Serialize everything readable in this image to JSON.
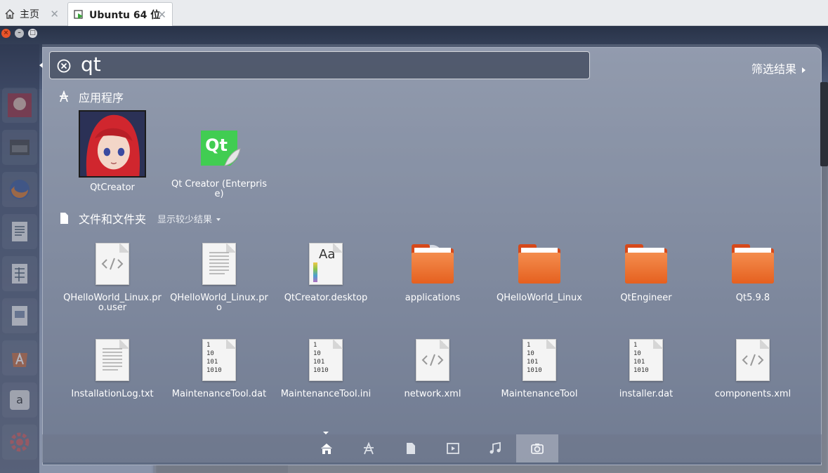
{
  "tabs": [
    {
      "label": "主页",
      "icon": "home-icon"
    },
    {
      "label": "Ubuntu 64 位",
      "icon": "vm-icon",
      "active": true
    }
  ],
  "search": {
    "query": "qt"
  },
  "filter_label": "筛选结果",
  "categories": {
    "apps": {
      "title": "应用程序",
      "icon": "apps-icon"
    },
    "files": {
      "title": "文件和文件夹",
      "icon": "file-icon",
      "show_less": "显示较少结果"
    }
  },
  "apps": [
    {
      "label": "QtCreator",
      "icon": "anime-avatar-icon"
    },
    {
      "label": "Qt Creator (Enterprise)",
      "icon": "qt-logo-icon"
    }
  ],
  "files": [
    {
      "label": "QHelloWorld_Linux.pro.user",
      "kind": "code"
    },
    {
      "label": "QHelloWorld_Linux.pro",
      "kind": "text"
    },
    {
      "label": "QtCreator.desktop",
      "kind": "font"
    },
    {
      "label": "applications",
      "kind": "folder"
    },
    {
      "label": "QHelloWorld_Linux",
      "kind": "folder"
    },
    {
      "label": "QtEngineer",
      "kind": "folder"
    },
    {
      "label": "Qt5.9.8",
      "kind": "folder"
    },
    {
      "label": "InstallationLog.txt",
      "kind": "text"
    },
    {
      "label": "MaintenanceTool.dat",
      "kind": "binary"
    },
    {
      "label": "MaintenanceTool.ini",
      "kind": "binary"
    },
    {
      "label": "network.xml",
      "kind": "code"
    },
    {
      "label": "MaintenanceTool",
      "kind": "binary"
    },
    {
      "label": "installer.dat",
      "kind": "binary"
    },
    {
      "label": "components.xml",
      "kind": "code"
    }
  ],
  "binary_text": [
    "1",
    "10",
    "101",
    "1010"
  ],
  "font_text": "Aa",
  "qt_logo_text": "Qt",
  "lenses": [
    {
      "name": "home-lens",
      "icon": "home-icon"
    },
    {
      "name": "apps-lens",
      "icon": "apps-icon"
    },
    {
      "name": "files-lens",
      "icon": "file-icon"
    },
    {
      "name": "video-lens",
      "icon": "video-icon"
    },
    {
      "name": "music-lens",
      "icon": "music-icon"
    },
    {
      "name": "photo-lens",
      "icon": "camera-icon"
    }
  ],
  "colors": {
    "folder": "#e5601f",
    "close": "#e8542a",
    "qt_green": "#41cd52"
  }
}
